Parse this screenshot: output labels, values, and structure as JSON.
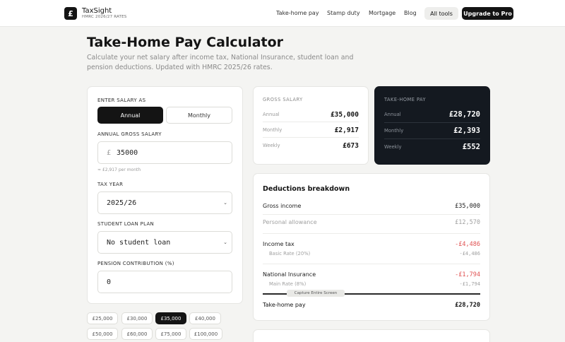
{
  "header": {
    "logo_glyph": "£",
    "brand": "TaxSight",
    "brand_sub": "HMRC 2026/27 RATES",
    "nav": [
      "Take-home pay",
      "Stamp duty",
      "Mortgage",
      "Blog"
    ],
    "all_tools": "All tools",
    "upgrade": "Upgrade to Pro"
  },
  "page": {
    "title": "Take-Home Pay Calculator",
    "description": "Calculate your net salary after income tax, National Insurance, student loan and pension deductions. Updated with HMRC 2025/26 rates."
  },
  "form": {
    "enter_salary_as": "ENTER SALARY AS",
    "annual": "Annual",
    "monthly": "Monthly",
    "gross_label": "ANNUAL GROSS SALARY",
    "currency_prefix": "£",
    "gross_value": "35000",
    "gross_hint": "≈ £2,917 per month",
    "tax_year_label": "TAX YEAR",
    "tax_year_value": "2025/26",
    "student_loan_label": "STUDENT LOAN PLAN",
    "student_loan_value": "No student loan",
    "pension_label": "PENSION CONTRIBUTION (%)",
    "pension_value": "0"
  },
  "presets": [
    "£25,000",
    "£30,000",
    "£35,000",
    "£40,000",
    "£50,000",
    "£60,000",
    "£75,000",
    "£100,000"
  ],
  "selected_preset": "£35,000",
  "gross_card": {
    "heading": "GROSS SALARY",
    "rows": [
      {
        "label": "Annual",
        "value": "£35,000"
      },
      {
        "label": "Monthly",
        "value": "£2,917"
      },
      {
        "label": "Weekly",
        "value": "£673"
      }
    ]
  },
  "net_card": {
    "heading": "TAKE-HOME PAY",
    "rows": [
      {
        "label": "Annual",
        "value": "£28,720"
      },
      {
        "label": "Monthly",
        "value": "£2,393"
      },
      {
        "label": "Weekly",
        "value": "£552"
      }
    ]
  },
  "deductions": {
    "title": "Deductions breakdown",
    "gross_income_label": "Gross income",
    "gross_income_value": "£35,000",
    "personal_allowance_label": "Personal allowance",
    "personal_allowance_value": "£12,570",
    "income_tax_label": "Income tax",
    "income_tax_value": "-£4,486",
    "basic_rate_label": "Basic Rate (20%)",
    "basic_rate_value": "-£4,486",
    "ni_label": "National Insurance",
    "ni_value": "-£1,794",
    "main_rate_label": "Main Rate (8%)",
    "main_rate_value": "-£1,794",
    "take_home_label": "Take-home pay",
    "take_home_value": "£28,720"
  },
  "tooltip": "Capture Entire Screen",
  "colors": {
    "accent_dark": "#141414",
    "negative": "#e05252",
    "background": "#f4f4f2"
  }
}
